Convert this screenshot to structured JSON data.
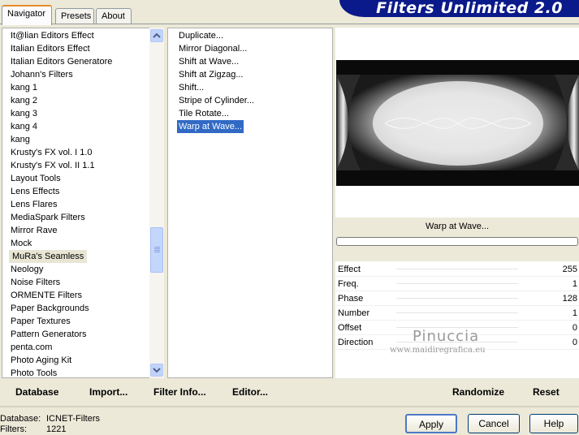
{
  "tabs": [
    {
      "label": "Navigator",
      "active": true
    },
    {
      "label": "Presets",
      "active": false
    },
    {
      "label": "About",
      "active": false
    }
  ],
  "banner_title": "Filters Unlimited 2.0",
  "categories": [
    "It@lian Editors Effect",
    "Italian Editors Effect",
    "Italian Editors Generatore",
    "Johann's Filters",
    "kang 1",
    "kang 2",
    "kang 3",
    "kang 4",
    "kang",
    "Krusty's FX vol. I 1.0",
    "Krusty's FX vol. II 1.1",
    "Layout Tools",
    "Lens Effects",
    "Lens Flares",
    "MediaSpark Filters",
    "Mirror Rave",
    "Mock",
    "MuRa's Seamless",
    "Neology",
    "Noise Filters",
    "ORMENTE Filters",
    "Paper Backgrounds",
    "Paper Textures",
    "Pattern Generators",
    "penta.com",
    "Photo Aging Kit",
    "Photo Tools"
  ],
  "selected_category": "MuRa's Seamless",
  "filters": [
    "Duplicate...",
    "Mirror Diagonal...",
    "Shift at Wave...",
    "Shift at Zigzag...",
    "Shift...",
    "Stripe of Cylinder...",
    "Tile Rotate...",
    "Warp at Wave..."
  ],
  "selected_filter": "Warp at Wave...",
  "preview_name": "Warp at Wave...",
  "params": [
    {
      "label": "Effect",
      "value": "255"
    },
    {
      "label": "Freq.",
      "value": "1"
    },
    {
      "label": "Phase",
      "value": "128"
    },
    {
      "label": "Number",
      "value": "1"
    },
    {
      "label": "Offset",
      "value": "0"
    },
    {
      "label": "Direction",
      "value": "0"
    }
  ],
  "watermark": {
    "name": "Pinuccia",
    "site": "www.maidiregrafica.eu"
  },
  "toolbar": {
    "database": "Database",
    "import": "Import...",
    "filter_info": "Filter Info...",
    "editor": "Editor...",
    "randomize": "Randomize",
    "reset": "Reset"
  },
  "status": {
    "database_label": "Database:",
    "database_value": "ICNET-Filters",
    "filters_label": "Filters:",
    "filters_value": "1221"
  },
  "buttons": {
    "apply": "Apply",
    "cancel": "Cancel",
    "help": "Help"
  },
  "scroll_up_icon": "up-arrow",
  "scroll_down_icon": "down-arrow"
}
